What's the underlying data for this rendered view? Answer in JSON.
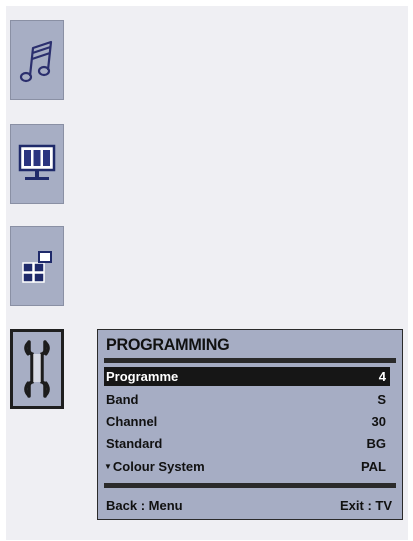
{
  "sidebar": {
    "items": [
      {
        "icon": "music-note-icon"
      },
      {
        "icon": "picture-monitor-icon"
      },
      {
        "icon": "feature-blocks-icon"
      },
      {
        "icon": "wrench-icon",
        "active": true
      }
    ]
  },
  "menu": {
    "title": "PROGRAMMING",
    "rows": [
      {
        "label": "Programme",
        "value": "4",
        "selected": true
      },
      {
        "label": "Band",
        "value": "S"
      },
      {
        "label": "Channel",
        "value": "30"
      },
      {
        "label": "Standard",
        "value": "BG"
      },
      {
        "label": "Colour System",
        "value": "PAL",
        "arrow": "▼"
      }
    ],
    "footer": {
      "back": "Back : Menu",
      "exit": "Exit : TV"
    }
  },
  "colors": {
    "panel": "#a6adc4",
    "highlight": "#161616",
    "background": "#efeff3"
  }
}
